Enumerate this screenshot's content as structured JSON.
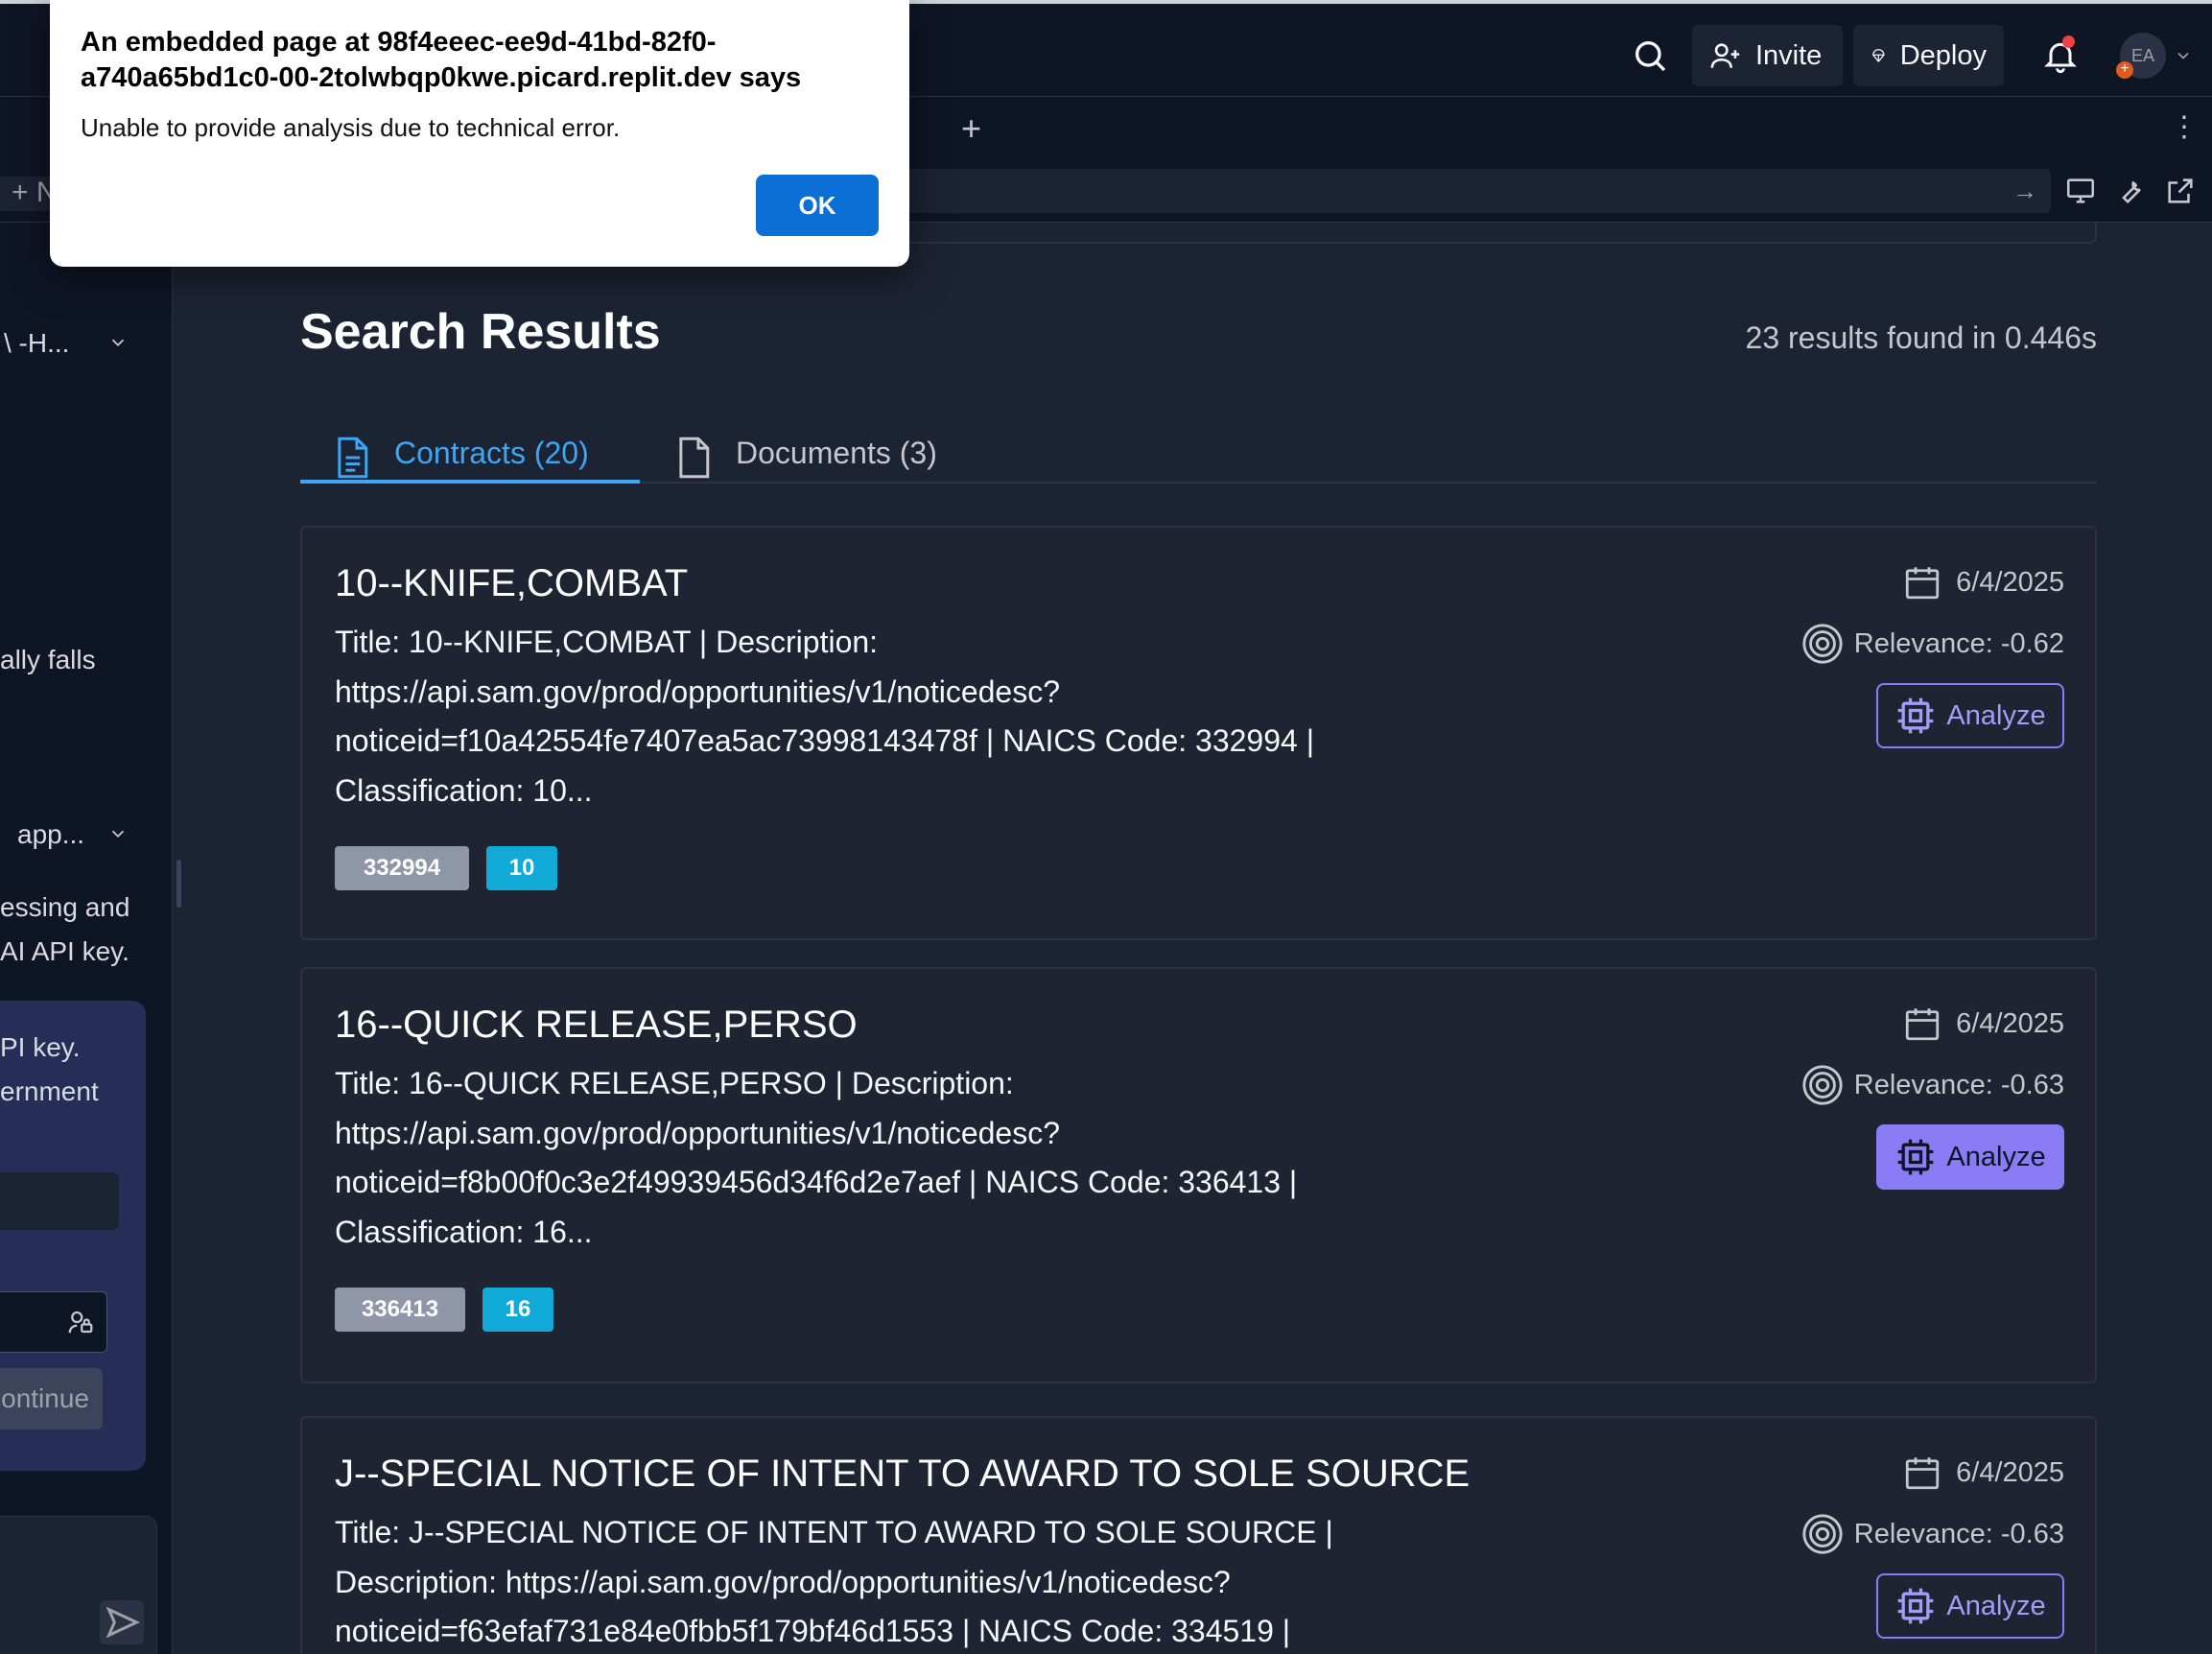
{
  "topbar": {
    "invite_label": "Invite",
    "deploy_label": "Deploy",
    "avatar_initials": "EA",
    "avatar_badge": "+",
    "icons": [
      "search-icon",
      "invite-person-icon",
      "deploy-icon",
      "bell-icon",
      "chevron-down-icon"
    ]
  },
  "tabstrip": {
    "add_label": "+",
    "more_label": "⋮"
  },
  "urlbar": {
    "go_label": "→",
    "left_newtab_label": "+ N"
  },
  "left_panel": {
    "row1_label": "\\  -H...",
    "fragment_falls": "ally falls",
    "row2_label": "app...",
    "fragment_line1": "essing and",
    "fragment_line2": "AI API key.",
    "card_line1": "PI key.",
    "card_line2": "ernment",
    "continue_label": "ontinue"
  },
  "main": {
    "title": "Search Results",
    "result_count": "23 results found in 0.446s",
    "tabs": [
      {
        "label": "Contracts (20)",
        "active": true
      },
      {
        "label": "Documents (3)",
        "active": false
      }
    ]
  },
  "results": [
    {
      "title": "10--KNIFE,COMBAT",
      "description": "Title: 10--KNIFE,COMBAT | Description: https://api.sam.gov/prod/opportunities/v1/noticedesc?noticeid=f10a42554fe7407ea5ac73998143478f | NAICS Code: 332994 | Classification: 10...",
      "date": "6/4/2025",
      "relevance": "Relevance: -0.62",
      "analyze_label": "Analyze",
      "naics_tag": "332994",
      "class_tag": "10"
    },
    {
      "title": "16--QUICK RELEASE,PERSO",
      "description": "Title: 16--QUICK RELEASE,PERSO | Description: https://api.sam.gov/prod/opportunities/v1/noticedesc?noticeid=f8b00f0c3e2f49939456d34f6d2e7aef | NAICS Code: 336413 | Classification: 16...",
      "date": "6/4/2025",
      "relevance": "Relevance: -0.63",
      "analyze_label": "Analyze",
      "naics_tag": "336413",
      "class_tag": "16"
    },
    {
      "title": "J--SPECIAL NOTICE OF INTENT TO AWARD TO SOLE SOURCE",
      "description": "Title: J--SPECIAL NOTICE OF INTENT TO AWARD TO SOLE SOURCE | Description: https://api.sam.gov/prod/opportunities/v1/noticedesc?noticeid=f63efaf731e84e0fbb5f179bf46d1553 | NAICS Code: 334519 |",
      "date": "6/4/2025",
      "relevance": "Relevance: -0.63",
      "analyze_label": "Analyze"
    }
  ],
  "dialog": {
    "heading": "An embedded page at 98f4eeec-ee9d-41bd-82f0-a740a65bd1c0-00-2tolwbqp0kwe.picard.replit.dev says",
    "message": "Unable to provide analysis due to technical error.",
    "ok_label": "OK"
  },
  "colors": {
    "accent_blue": "#3ea6f2",
    "analyze_purple": "#8b7cf6",
    "tag_gray": "#8e96a8",
    "tag_cyan": "#11a9d6",
    "dialog_button": "#0c6fd6"
  }
}
